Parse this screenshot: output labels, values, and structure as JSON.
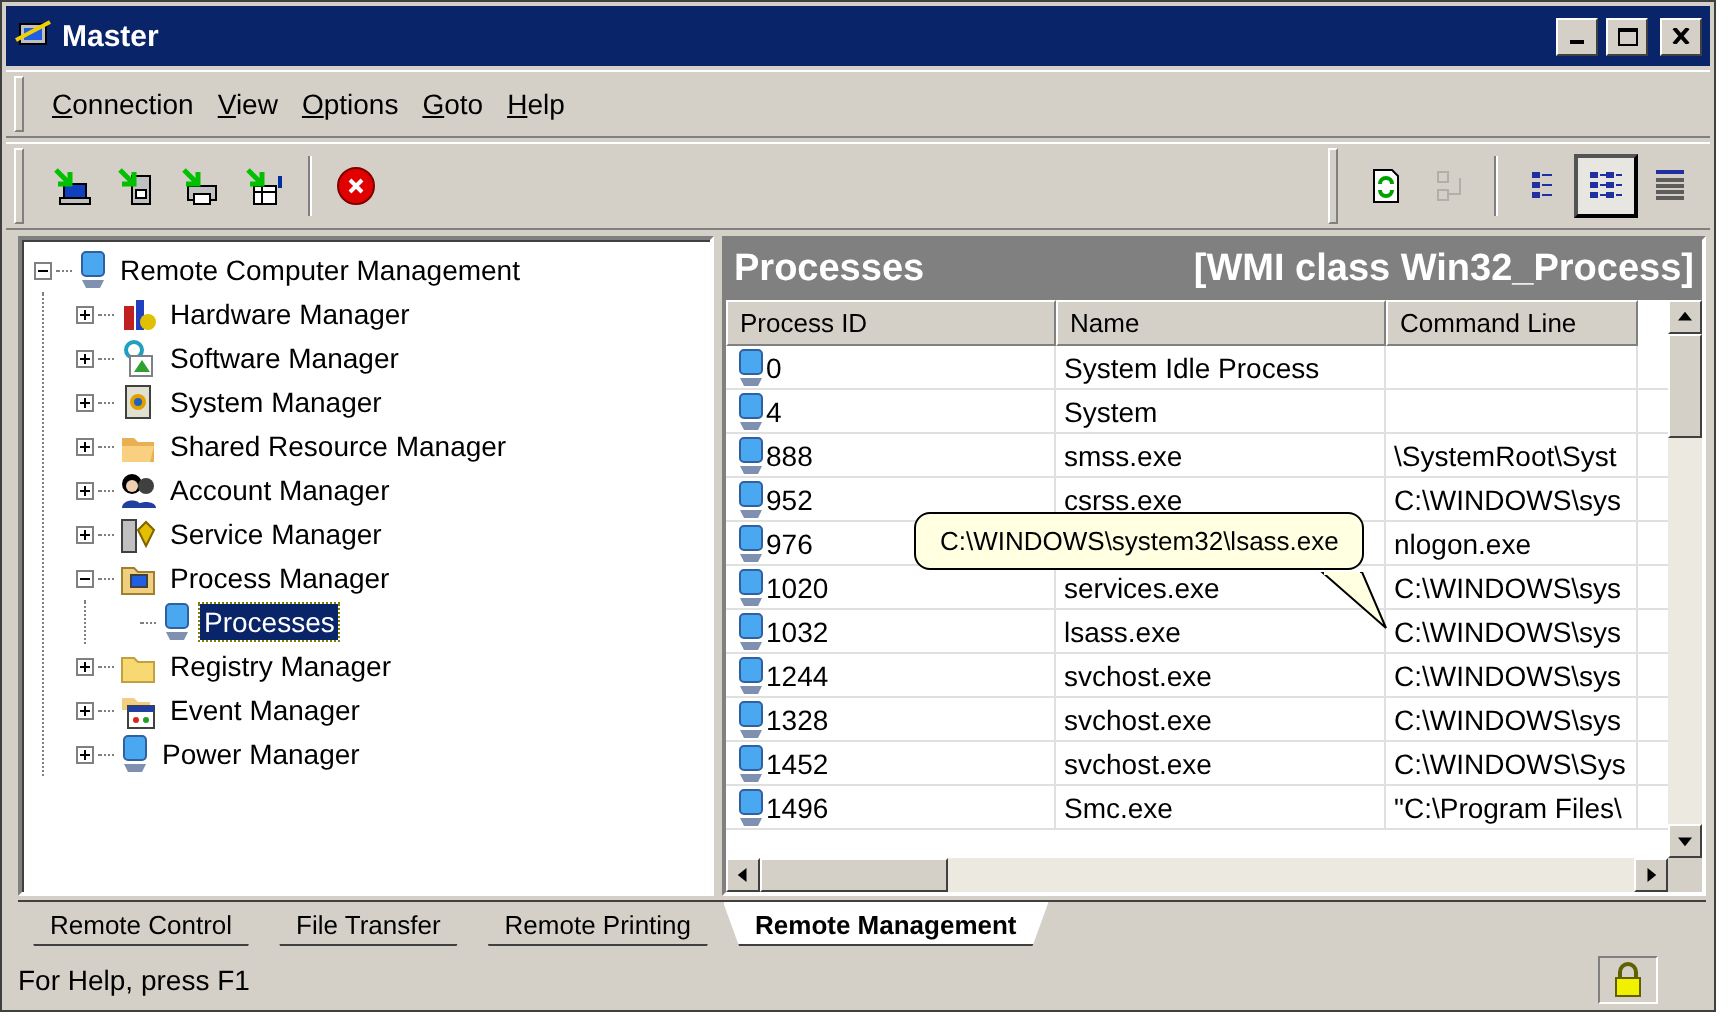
{
  "window": {
    "title": "Master"
  },
  "menu": [
    "Connection",
    "View",
    "Options",
    "Goto",
    "Help"
  ],
  "view_tools": [
    {
      "selected": false,
      "disabled": false
    },
    {
      "selected": false,
      "disabled": true
    },
    {
      "selected": false,
      "disabled": false
    },
    {
      "selected": true,
      "disabled": false
    },
    {
      "selected": false,
      "disabled": false
    }
  ],
  "tree": {
    "label": "Remote Computer Management",
    "expanded": true,
    "children": [
      {
        "label": "Hardware Manager",
        "expanded": false
      },
      {
        "label": "Software Manager",
        "expanded": false
      },
      {
        "label": "System Manager",
        "expanded": false
      },
      {
        "label": "Shared Resource Manager",
        "expanded": false
      },
      {
        "label": "Account Manager",
        "expanded": false
      },
      {
        "label": "Service Manager",
        "expanded": false
      },
      {
        "label": "Process Manager",
        "expanded": true,
        "children": [
          {
            "label": "Processes",
            "selected": true
          }
        ]
      },
      {
        "label": "Registry Manager",
        "expanded": false
      },
      {
        "label": "Event Manager",
        "expanded": false
      },
      {
        "label": "Power Manager",
        "expanded": false
      }
    ]
  },
  "panel": {
    "title": "Processes",
    "subtitle": "[WMI class Win32_Process]"
  },
  "table": {
    "columns": [
      "Process ID",
      "Name",
      "Command Line"
    ],
    "rows": [
      [
        "0",
        "System Idle Process",
        ""
      ],
      [
        "4",
        "System",
        ""
      ],
      [
        "888",
        "smss.exe",
        "\\SystemRoot\\Syst"
      ],
      [
        "952",
        "csrss.exe",
        "C:\\WINDOWS\\sys"
      ],
      [
        "976",
        "",
        "nlogon.exe"
      ],
      [
        "1020",
        "services.exe",
        "C:\\WINDOWS\\sys"
      ],
      [
        "1032",
        "lsass.exe",
        "C:\\WINDOWS\\sys"
      ],
      [
        "1244",
        "svchost.exe",
        "C:\\WINDOWS\\sys"
      ],
      [
        "1328",
        "svchost.exe",
        "C:\\WINDOWS\\sys"
      ],
      [
        "1452",
        "svchost.exe",
        "C:\\WINDOWS\\Sys"
      ],
      [
        "1496",
        "Smc.exe",
        "\"C:\\Program Files\\"
      ]
    ]
  },
  "tooltip": "C:\\WINDOWS\\system32\\lsass.exe",
  "tabs": [
    {
      "label": "Remote Control",
      "selected": false
    },
    {
      "label": "File Transfer",
      "selected": false
    },
    {
      "label": "Remote Printing",
      "selected": false
    },
    {
      "label": "Remote Management",
      "selected": true
    }
  ],
  "status_bar": "For Help, press F1"
}
